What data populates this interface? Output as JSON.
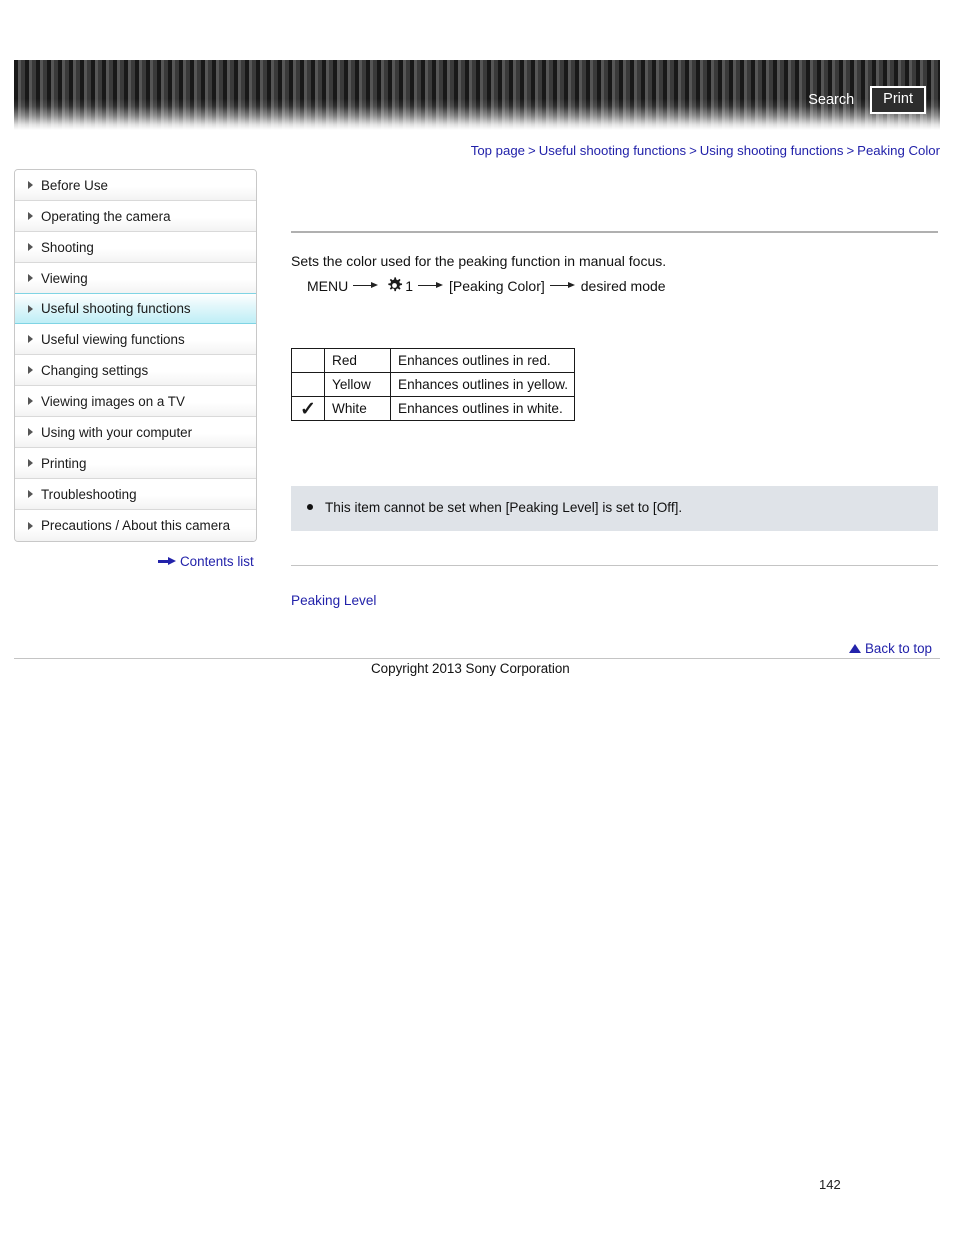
{
  "header": {
    "search_label": "Search",
    "print_label": "Print",
    "accent_dark": "#141414",
    "accent_light": "#565656"
  },
  "breadcrumb": {
    "separator": ">",
    "items": [
      {
        "label": "Top page"
      },
      {
        "label": "Useful shooting functions"
      },
      {
        "label": "Using shooting functions"
      },
      {
        "label": "Peaking Color"
      }
    ],
    "link_color": "#2222aa"
  },
  "sidebar": {
    "items": [
      {
        "label": "Before Use",
        "active": false
      },
      {
        "label": "Operating the camera",
        "active": false
      },
      {
        "label": "Shooting",
        "active": false
      },
      {
        "label": "Viewing",
        "active": false
      },
      {
        "label": "Useful shooting functions",
        "active": true
      },
      {
        "label": "Useful viewing functions",
        "active": false
      },
      {
        "label": "Changing settings",
        "active": false
      },
      {
        "label": "Viewing images on a TV",
        "active": false
      },
      {
        "label": "Using with your computer",
        "active": false
      },
      {
        "label": "Printing",
        "active": false
      },
      {
        "label": "Troubleshooting",
        "active": false
      },
      {
        "label": "Precautions / About this camera",
        "active": false
      }
    ],
    "active_bg": "#bfeef6",
    "active_border": "#7fd4e4",
    "contents_list_label": "Contents list",
    "contents_list_icon": "right-arrow-icon"
  },
  "main": {
    "intro_text": "Sets the color used for the peaking function in manual focus.",
    "menu_path": {
      "menu_label": "MENU",
      "gear_icon": "gear-icon",
      "gear_page": "1",
      "setting_label": "[Peaking Color]",
      "result_label": "desired mode",
      "arrow_icon": "right-arrow-icon"
    },
    "options_table": {
      "check_glyph": "✓",
      "rows": [
        {
          "checked": false,
          "name": "Red",
          "description": "Enhances outlines in red."
        },
        {
          "checked": false,
          "name": "Yellow",
          "description": "Enhances outlines in yellow."
        },
        {
          "checked": true,
          "name": "White",
          "description": "Enhances outlines in white."
        }
      ]
    },
    "note": {
      "bullet_icon": "bullet-icon",
      "text": "This item cannot be set when [Peaking Level] is set to [Off].",
      "background": "#dfe3e8"
    },
    "related_link_label": "Peaking Level",
    "back_to_top_label": "Back to top",
    "back_to_top_icon": "triangle-up-icon"
  },
  "footer": {
    "copyright": "Copyright 2013 Sony Corporation",
    "page_number": "142"
  }
}
